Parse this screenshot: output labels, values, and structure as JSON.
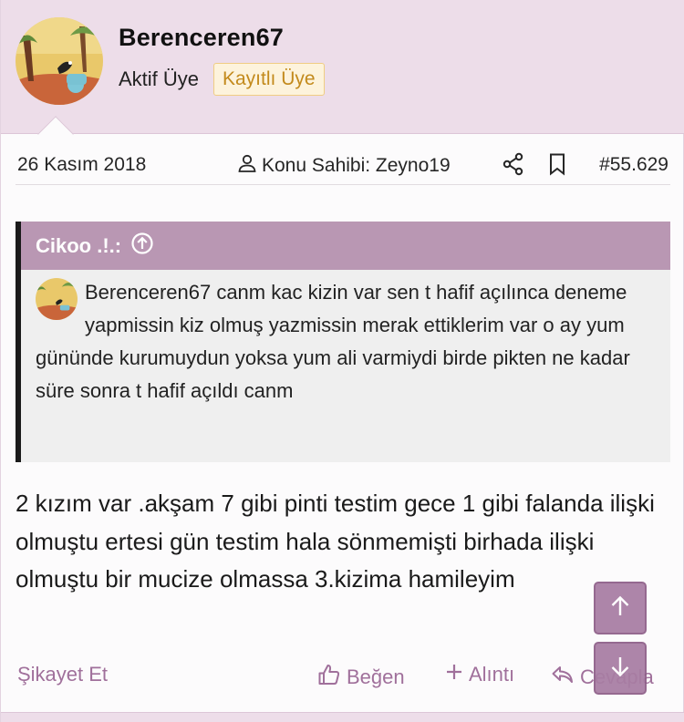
{
  "user": {
    "name": "Berenceren67",
    "title": "Aktif Üye",
    "badge": "Kayıtlı Üye"
  },
  "meta": {
    "date": "26 Kasım 2018",
    "owner": "Konu Sahibi: Zeyno19",
    "post_number": "#55.629"
  },
  "quote": {
    "author": "Cikoo .!.:",
    "text": "Berenceren67 canm kac kizin var sen t hafif açılınca deneme yapmissin kiz olmuş yazmissin merak ettiklerim var o ay yum gününde kurumuydun yoksa yum ali varmiydi birde pikten ne kadar süre sonra t hafif açıldı canm"
  },
  "message": "2 kızım var .akşam 7 gibi pinti testim gece 1 gibi falanda ilişki olmuştu ertesi gün testim hala sönmemişti birhada ilişki olmuştu bir mucize olmassa 3.kizima hamileyim",
  "actions": {
    "report": "Şikayet Et",
    "like": "Beğen",
    "quote": "Alıntı",
    "reply": "Cevapla"
  },
  "colors": {
    "header_bg": "#eddde9",
    "accent": "#a0709b",
    "quote_head": "#b997b3",
    "badge_text": "#c38a1c"
  },
  "icons": [
    "user-icon",
    "share-icon",
    "bookmark-icon",
    "arrow-up-circle-icon",
    "thumbs-up-icon",
    "plus-icon",
    "reply-icon",
    "arrow-up-icon",
    "arrow-down-icon"
  ]
}
